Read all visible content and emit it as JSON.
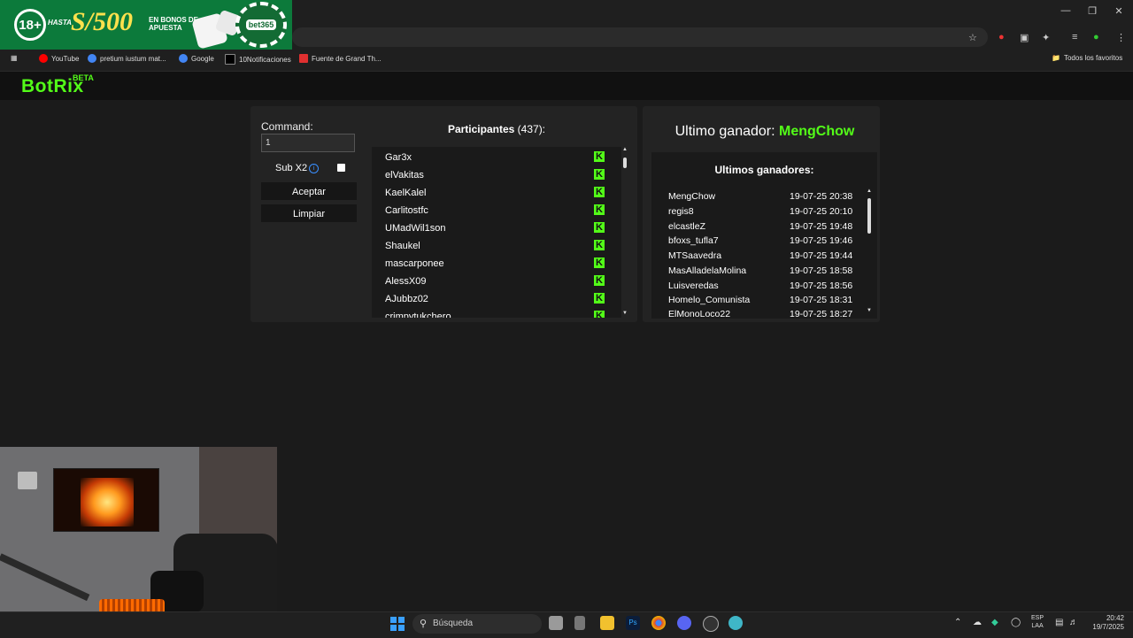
{
  "ad": {
    "age": "18+",
    "hasta": "HASTA",
    "amount": "S/500",
    "bonos": "EN BONOS DE APUESTA",
    "brand": "bet365"
  },
  "bookmarks": [
    {
      "label": "YouTube",
      "icon": "youtube-icon",
      "color": "#ff0000"
    },
    {
      "label": "pretium iustum mat...",
      "icon": "google-icon",
      "color": "#4285f4"
    },
    {
      "label": "Google",
      "icon": "google-icon",
      "color": "#4285f4"
    },
    {
      "label": "10Notificaciones",
      "icon": "x-icon",
      "color": "#000000"
    },
    {
      "label": "Fuente de Grand Th...",
      "icon": "font-icon",
      "color": "#e03030"
    }
  ],
  "bookmarks_all": "Todos los favoritos",
  "app": {
    "logo": "BotRix",
    "beta": "BETA"
  },
  "command": {
    "label": "Command:",
    "value": "1"
  },
  "sub": {
    "label": "Sub X2",
    "info": "i"
  },
  "buttons": {
    "accept": "Aceptar",
    "clear": "Limpiar"
  },
  "participants": {
    "title": "Participantes",
    "count": "(437):",
    "names": [
      "Gar3x",
      "elVakitas",
      "KaelKalel",
      "Carlitostfc",
      "UMadWil1son",
      "Shaukel",
      "mascarponee",
      "AlessX09",
      "AJubbz02",
      "crimpytukchero"
    ]
  },
  "last_winner": {
    "label": "Ultimo ganador:",
    "name": "MengChow"
  },
  "winners": {
    "title": "Ultimos ganadores:",
    "rows": [
      {
        "name": "MengChow",
        "date": "19-07-25 20:38"
      },
      {
        "name": "regis8",
        "date": "19-07-25 20:10"
      },
      {
        "name": "elcastleZ",
        "date": "19-07-25 19:48"
      },
      {
        "name": "bfoxs_tufla7",
        "date": "19-07-25 19:46"
      },
      {
        "name": "MTSaavedra",
        "date": "19-07-25 19:44"
      },
      {
        "name": "MasAlladelaMolina",
        "date": "19-07-25 18:58"
      },
      {
        "name": "Luisveredas",
        "date": "19-07-25 18:56"
      },
      {
        "name": "Homelo_Comunista",
        "date": "19-07-25 18:31"
      },
      {
        "name": "ElMonoLoco22",
        "date": "19-07-25 18:27"
      }
    ]
  },
  "taskbar": {
    "search": "Búsqueda",
    "lang1": "ESP",
    "lang2": "LAA",
    "time": "20:42",
    "date": "19/7/2025"
  },
  "colors": {
    "accent": "#53fc18",
    "panel": "#232323",
    "list": "#1a1a1a"
  }
}
